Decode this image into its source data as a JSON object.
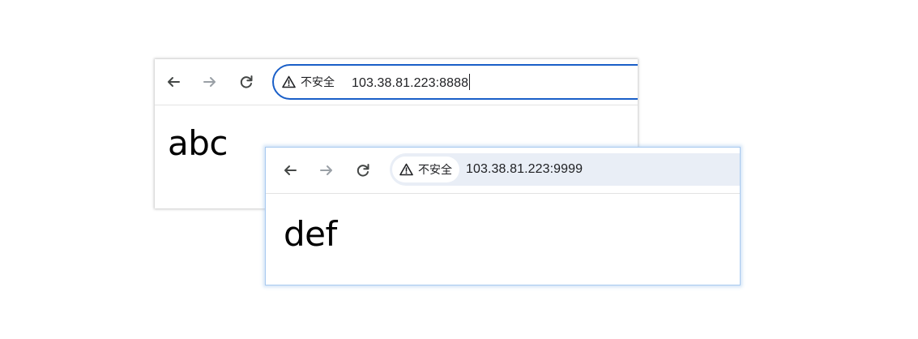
{
  "windows": [
    {
      "security_label": "不安全",
      "url": "103.38.81.223:8888",
      "page_text": "abc",
      "omnibox_focused": true
    },
    {
      "security_label": "不安全",
      "url": "103.38.81.223:9999",
      "page_text": "def",
      "omnibox_focused": false
    }
  ],
  "colors": {
    "focus_ring": "#1a5fc8",
    "omnibox_bg": "#e9eef6",
    "active_window_border": "#a8c9ef",
    "icon": "#444746",
    "icon_disabled": "#9aa0a6"
  }
}
